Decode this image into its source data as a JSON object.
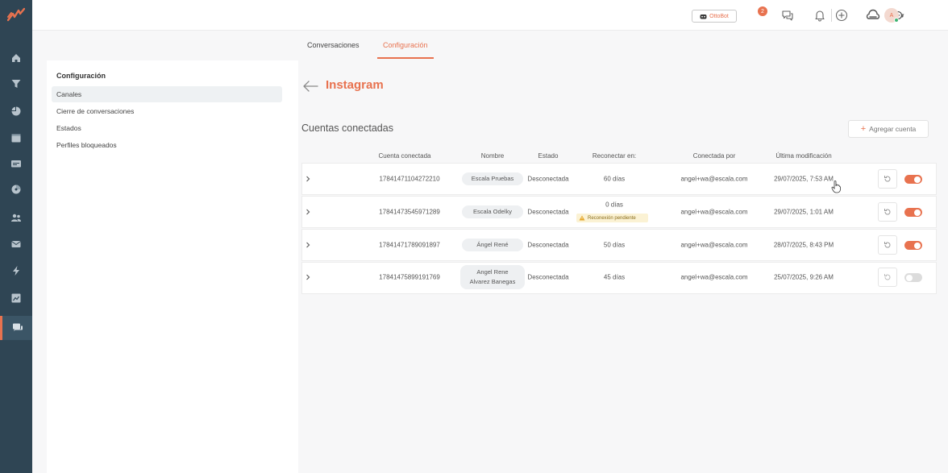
{
  "topbar": {
    "ottobot_label": "OttoBot",
    "notification_count": "2",
    "avatar_initial": "A"
  },
  "tabs": [
    {
      "label": "Conversaciones",
      "active": false
    },
    {
      "label": "Configuración",
      "active": true
    }
  ],
  "settings": {
    "title": "Configuración",
    "items": [
      {
        "label": "Canales",
        "active": true
      },
      {
        "label": "Cierre de conversaciones",
        "active": false
      },
      {
        "label": "Estados",
        "active": false
      },
      {
        "label": "Perfiles bloqueados",
        "active": false
      }
    ]
  },
  "page": {
    "title": "Instagram",
    "section_title": "Cuentas conectadas",
    "add_button": "Agregar cuenta"
  },
  "table": {
    "headers": [
      "Cuenta conectada",
      "Nombre",
      "Estado",
      "Reconectar en:",
      "Conectada por",
      "Última modificación"
    ],
    "rows": [
      {
        "account": "17841471104272210",
        "name": "Escala Pruebas",
        "status": "Desconectada",
        "reconnect": "60 días",
        "connected_by": "angel+wa@escala.com",
        "modified": "29/07/2025, 7:53 AM",
        "enabled": true
      },
      {
        "account": "17841473545971289",
        "name": "Escala Odelky",
        "status": "Desconectada",
        "reconnect": "0 días",
        "warning": "Reconexión pendiente",
        "connected_by": "angel+wa@escala.com",
        "modified": "29/07/2025, 1:01 AM",
        "enabled": true
      },
      {
        "account": "17841471789091897",
        "name": "Ángel René",
        "status": "Desconectada",
        "reconnect": "50 días",
        "connected_by": "angel+wa@escala.com",
        "modified": "28/07/2025, 8:43 PM",
        "enabled": true
      },
      {
        "account": "17841475899191769",
        "name_line1": "Angel Rene",
        "name_line2": "Alvarez Banegas",
        "status": "Desconectada",
        "reconnect": "45 días",
        "connected_by": "angel+wa@escala.com",
        "modified": "25/07/2025, 9:26 AM",
        "enabled": false
      }
    ]
  },
  "colors": {
    "accent": "#e8724f",
    "rail": "#2f4554",
    "warning_bg": "#fbf2d4"
  }
}
